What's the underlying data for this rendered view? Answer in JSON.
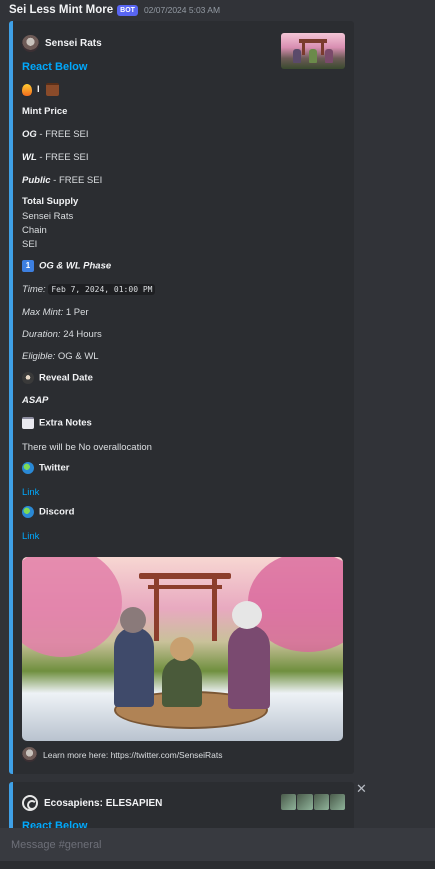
{
  "message": {
    "author": "Sei Less Mint More",
    "bot_badge": "BOT",
    "timestamp": "02/07/2024 5:03 AM"
  },
  "embed": {
    "author": "Sensei Rats",
    "title": "React Below",
    "reaction_line": "I",
    "mint_price_label": "Mint Price",
    "og_label": "OG",
    "og_value": " - FREE SEI",
    "wl_label": "WL",
    "wl_value": " - FREE SEI",
    "public_label": "Public",
    "public_value": " - FREE SEI",
    "total_supply_label": "Total Supply",
    "supply_line1": "Sensei Rats",
    "supply_line2": "Chain",
    "supply_line3": "SEI",
    "phase_icon": "1",
    "phase_label": "OG & WL Phase",
    "time_label": "Time:",
    "time_value": "Feb 7, 2024, 01:00 PM",
    "max_mint_label": "Max Mint:",
    "max_mint_value": " 1 Per",
    "duration_label": "Duration:",
    "duration_value": " 24 Hours",
    "eligible_label": "Eligible:",
    "eligible_value": " OG & WL",
    "reveal_label": "Reveal Date",
    "reveal_value": "ASAP",
    "notes_label": "Extra Notes",
    "notes_value": "There will be No overallocation",
    "twitter_label": "Twitter",
    "twitter_link": "Link",
    "discord_label": "Discord",
    "discord_link": "Link",
    "footer": "Learn more here: https://twitter.com/SenseiRats"
  },
  "embed2": {
    "author": "Ecosapiens: ELESAPIEN",
    "title": "React Below"
  },
  "composer": {
    "placeholder": "Message #general"
  },
  "icons": [
    "flame-icon",
    "briefcase-icon",
    "keycap-one-icon",
    "ninja-icon",
    "notepad-icon",
    "globe-icon",
    "close-icon"
  ],
  "colors": {
    "background": "#313338",
    "embed_background": "#2b2d31",
    "embed_accent": "#3fa0e6",
    "link": "#00a8fc",
    "bot_badge": "#5865f2"
  }
}
